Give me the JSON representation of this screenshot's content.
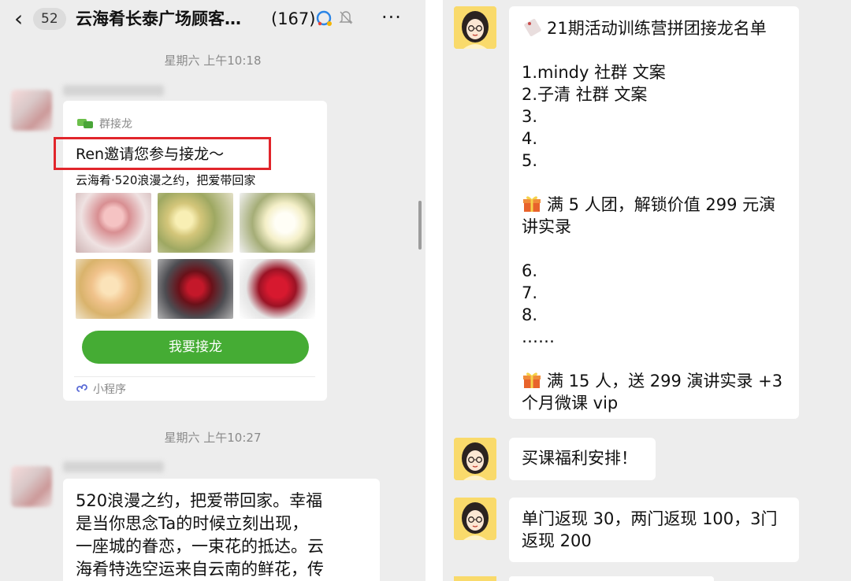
{
  "header": {
    "back_glyph": "‹",
    "unread_count": "52",
    "chat_title": "云海肴长泰广场顾客…",
    "member_count": "(167)",
    "more_glyph": "···"
  },
  "left_chat": {
    "timestamp_1": "星期六 上午10:18",
    "timestamp_2": "星期六 上午10:27",
    "mini_program": {
      "app_name": "群接龙",
      "invite_text": "Ren邀请您参与接龙～",
      "description": "云海肴·520浪漫之约，把爱带回家",
      "button_label": "我要接龙",
      "footer_label": "小程序",
      "highlight_color": "#e1252b",
      "button_color": "#45ac34"
    },
    "message_2_lines": [
      "520浪漫之约，把爱带回家。幸福",
      "是当你思念Ta的时候立刻出现，",
      "一座城的眷恋，一束花的抵达。云",
      "海肴特选空运来自云南的鲜花，传"
    ]
  },
  "right_chat": {
    "message_1": {
      "title": "21期活动训练营拼团接龙名单",
      "entries": [
        "1.mindy  社群  文案",
        "2.子清    社群  文案",
        "3.",
        "4.",
        "5."
      ],
      "reward_1_lines": [
        "满 5 人团，解锁价值 299 元演",
        "讲实录"
      ],
      "entries_2": [
        "6.",
        "7.",
        "8.",
        "……"
      ],
      "reward_2_lines": [
        "满 15 人，送 299 演讲实录 +3",
        "个月微课 vip"
      ]
    },
    "message_2": "买课福利安排！",
    "message_3_lines": [
      "单门返现 30，两门返现 100，3门",
      "返现 200"
    ],
    "avatar_color": "#f9da6b"
  },
  "icons": {
    "flag": "tag-icon",
    "gift": "gift-icon"
  }
}
